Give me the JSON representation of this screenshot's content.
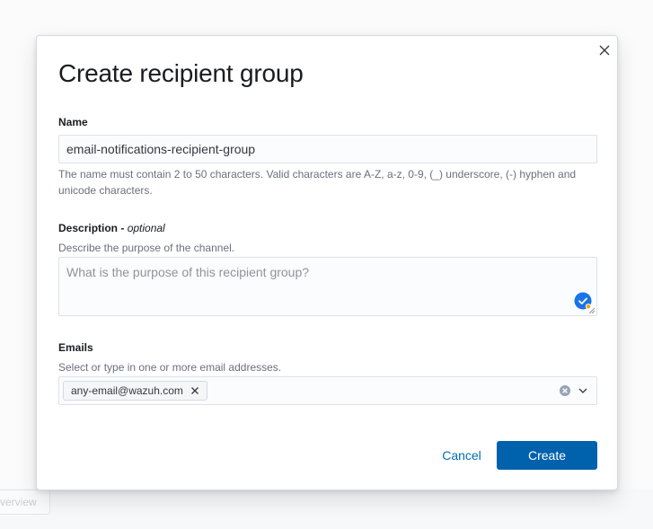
{
  "background": {
    "chip_text": "verview"
  },
  "modal": {
    "title": "Create recipient group",
    "name": {
      "label": "Name",
      "value": "email-notifications-recipient-group",
      "help": "The name must contain 2 to 50 characters. Valid characters are A-Z, a-z, 0-9, (_) underscore, (-) hyphen and unicode characters."
    },
    "description": {
      "label": "Description - ",
      "label_optional": "optional",
      "help": "Describe the purpose of the channel.",
      "placeholder": "What is the purpose of this recipient group?"
    },
    "emails": {
      "label": "Emails",
      "help": "Select or type in one or more email addresses.",
      "selected": [
        "any-email@wazuh.com"
      ]
    },
    "buttons": {
      "cancel": "Cancel",
      "create": "Create"
    }
  },
  "colors": {
    "primary": "#0061ad",
    "link": "#006bb4",
    "grammar_check": "#1a73e8",
    "grammar_dot": "#f5a623"
  },
  "icons": {
    "close": "close-icon",
    "pill_remove": "cross-icon",
    "clear": "clear-circle-icon",
    "chevron": "chevron-down-icon",
    "grammar": "grammar-check-icon"
  }
}
